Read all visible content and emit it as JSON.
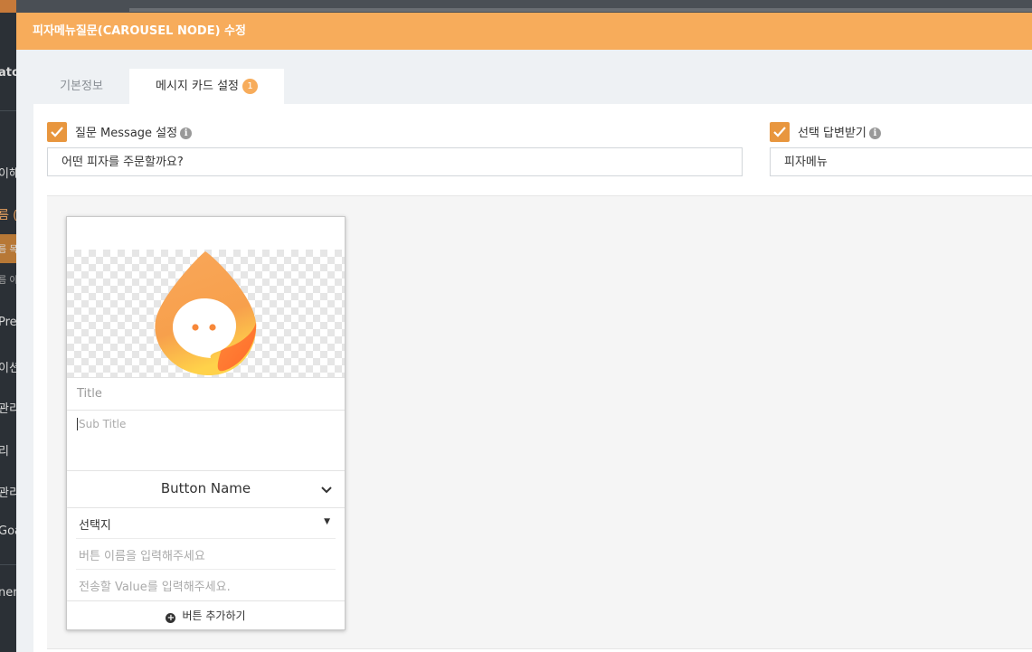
{
  "sidebar": {
    "items": [
      "ator",
      "이해",
      "름 (",
      "름 목",
      "름 이",
      "Pref",
      "이션",
      "관리",
      "리",
      "관리",
      "Goa",
      "nent"
    ]
  },
  "modal": {
    "title": "피자메뉴질문(CAROUSEL NODE) 수정",
    "tabs": [
      {
        "label": "기본정보",
        "active": false
      },
      {
        "label": "메시지 카드 설정",
        "active": true,
        "badge": "1"
      }
    ]
  },
  "question": {
    "checked": true,
    "label": "질문 Message 설정",
    "value": "어떤 피자를 주문할까요?"
  },
  "answer": {
    "checked": true,
    "label": "선택 답변받기",
    "value": "피자메뉴"
  },
  "card": {
    "image_icon": "chatbot-droplet-logo-icon",
    "title_placeholder": "Title",
    "subtitle_placeholder": "Sub Title",
    "button_name": "Button Name",
    "select_value": "선택지",
    "button_name_placeholder": "버튼 이름을 입력해주세요",
    "value_placeholder": "전송할 Value를 입력해주세요.",
    "add_button_label": "버튼 추가하기"
  },
  "colors": {
    "accent": "#f7ac5b",
    "checkbox": "#e8963e",
    "sidebar": "#2b3036"
  }
}
